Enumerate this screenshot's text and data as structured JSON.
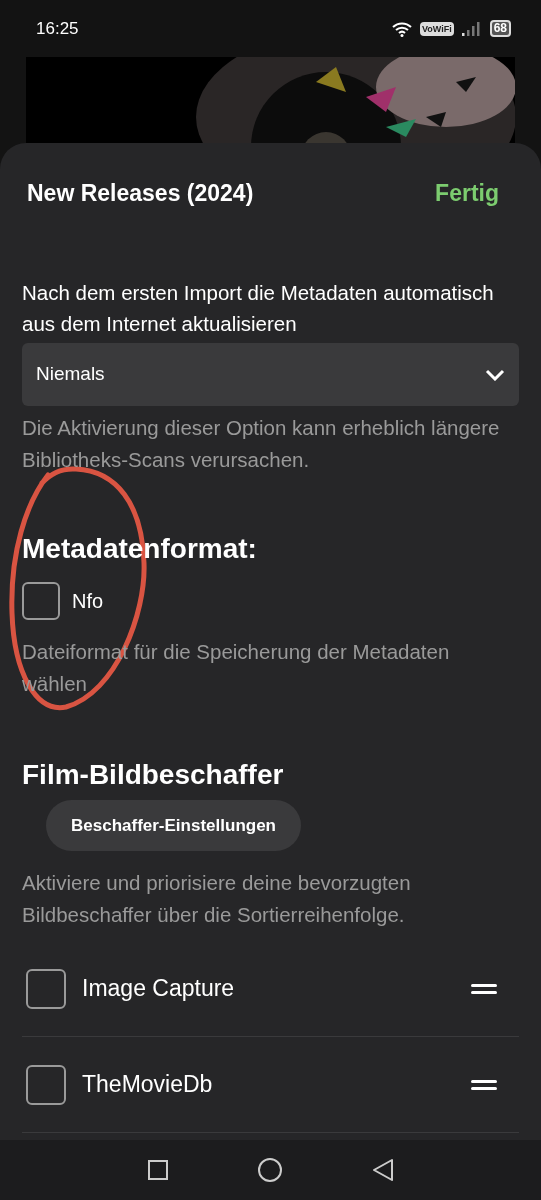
{
  "status_bar": {
    "time": "16:25",
    "vowifi": "VoWiFi",
    "battery": "68"
  },
  "sheet": {
    "title": "New Releases (2024)",
    "done": "Fertig",
    "refresh": {
      "label": "Nach dem ersten Import die Metadaten automatisch aus dem Internet aktualisieren",
      "value": "Niemals",
      "help": "Die Aktivierung dieser Option kann erheblich längere Bibliotheks-Scans verursachen."
    },
    "metadata_format": {
      "heading": "Metadatenformat:",
      "options": [
        {
          "label": "Nfo",
          "checked": false
        }
      ],
      "help": "Dateiformat für die Speicherung der Metadaten wählen"
    },
    "image_fetchers": {
      "heading": "Film-Bildbeschaffer",
      "button": "Beschaffer-Einstellungen",
      "help": "Aktiviere und priorisiere deine bevorzugten Bildbeschaffer über die Sortierreihenfolge.",
      "items": [
        {
          "label": "Image Capture",
          "checked": false
        },
        {
          "label": "TheMovieDb",
          "checked": false
        }
      ]
    }
  }
}
